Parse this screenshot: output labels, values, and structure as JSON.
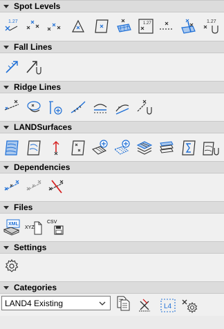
{
  "sections": {
    "spot_levels": {
      "title": "Spot Levels"
    },
    "fall_lines": {
      "title": "Fall Lines"
    },
    "ridge_lines": {
      "title": "Ridge Lines"
    },
    "landsurfaces": {
      "title": "LANDSurfaces"
    },
    "dependencies": {
      "title": "Dependencies"
    },
    "files": {
      "title": "Files"
    },
    "settings": {
      "title": "Settings"
    },
    "categories": {
      "title": "Categories"
    }
  },
  "icon_text": {
    "spot_127": "1.27",
    "spot_127_b": "1.27",
    "spot_127_c": "1.27",
    "xml": "XML",
    "xyz": "XYZ",
    "csv": "CSV",
    "l4": "L4"
  },
  "categories": {
    "selected": "LAND4 Existing"
  },
  "colors": {
    "accent_blue": "#1e6fd6",
    "header_bg": "#dcdcdc",
    "panel_bg": "#f0f0f0",
    "remove_red": "#d62020"
  }
}
